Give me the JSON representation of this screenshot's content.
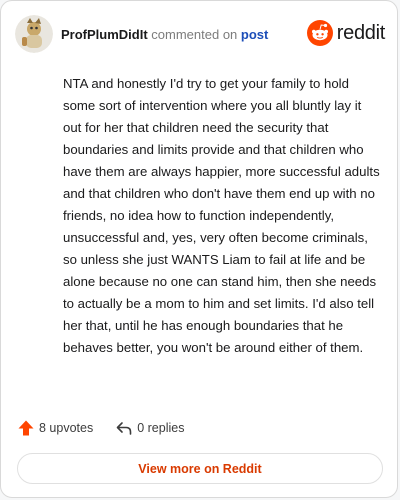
{
  "comment": {
    "author": "ProfPlumDidIt",
    "action_text": "commented on",
    "post_link_label": "post",
    "body": "NTA and honestly I'd try to get your family to hold some sort of intervention where you all bluntly lay it out for her that children need the security that boundaries and limits provide and that children who have them are always happier, more successful adults and that children who don't have them end up with no friends, no idea how to function independently, unsuccessful and, yes, very often become criminals, so unless she just WANTS Liam to fail at life and be alone because no one can stand him, then she needs to actually be a mom to him and set limits. I'd also tell her that, until he has enough boundaries that he behaves better, you won't be around either of them.",
    "upvotes_label": "8 upvotes",
    "replies_label": "0 replies"
  },
  "brand": {
    "wordmark": "reddit",
    "icon": "reddit-snoo-icon"
  },
  "footer": {
    "view_more_label": "View more on Reddit"
  },
  "colors": {
    "brand_orange": "#ff4500",
    "link_blue": "#1c4eb8",
    "cta_text": "#d93a00",
    "upvote_orange": "#ff4500"
  }
}
